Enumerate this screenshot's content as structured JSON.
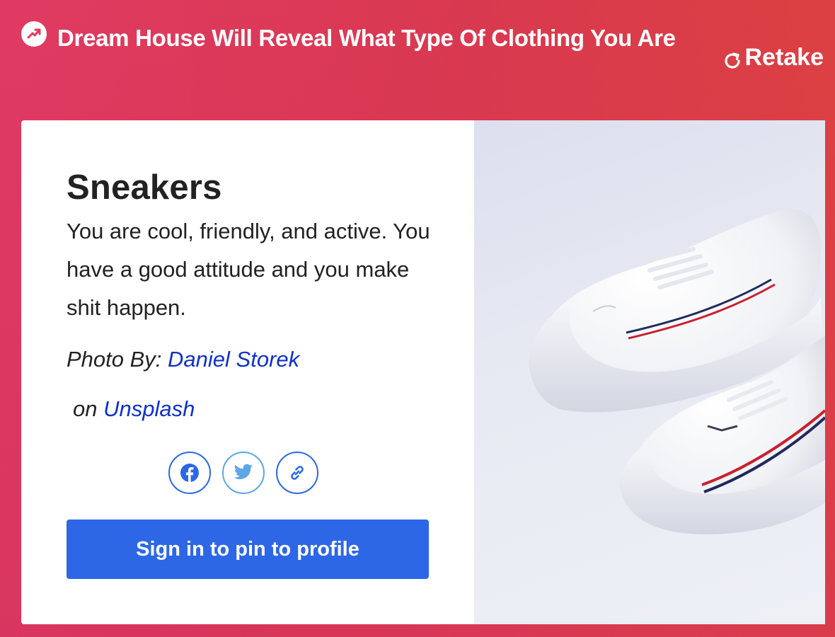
{
  "header": {
    "title": "Dream House Will Reveal What Type Of Clothing You Are",
    "retake_label": "Retake"
  },
  "result": {
    "title": "Sneakers",
    "description": "You are cool, friendly, and active. You have a good attitude and you make shit happen.",
    "photo_by_label": "Photo By:",
    "photographer": "Daniel Storek",
    "on_label": "on",
    "source": "Unsplash"
  },
  "share": {
    "icons": [
      "facebook-icon",
      "twitter-icon",
      "link-icon"
    ]
  },
  "pin_button_label": "Sign in to pin to profile",
  "colors": {
    "background_start": "#e03a63",
    "background_end": "#dd4539",
    "primary_button": "#2d67e6",
    "link": "#0f30cc"
  }
}
